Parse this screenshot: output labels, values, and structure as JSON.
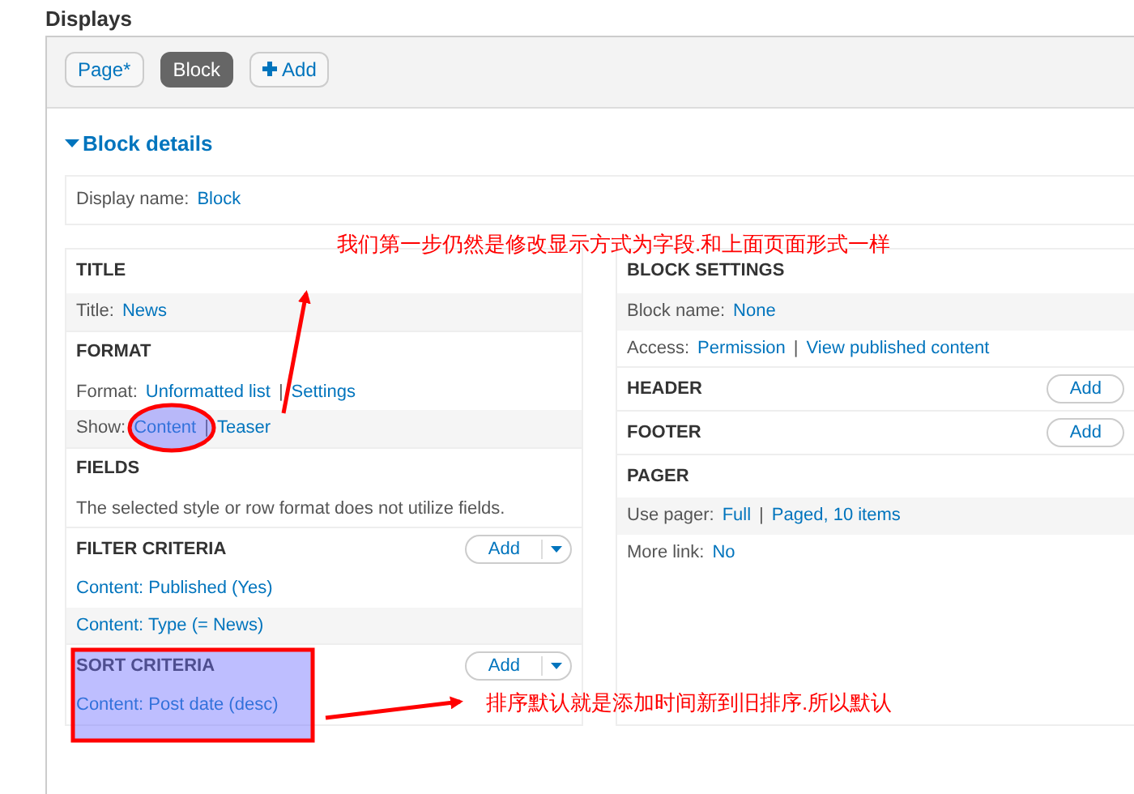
{
  "page_title": "Displays",
  "tabs": [
    {
      "label": "Page*",
      "kind": "tab",
      "selected": false
    },
    {
      "label": "Block",
      "kind": "tab",
      "selected": true
    },
    {
      "label": "Add",
      "kind": "add",
      "selected": false
    }
  ],
  "details": {
    "heading": "Block details",
    "expanded": true,
    "display_name": {
      "label": "Display name:",
      "value": "Block"
    }
  },
  "left_sections": [
    {
      "title": "TITLE",
      "rows": [
        {
          "striped": true,
          "parts": [
            {
              "kind": "label",
              "text": "Title:"
            },
            {
              "kind": "link",
              "text": "News"
            }
          ]
        }
      ]
    },
    {
      "title": "FORMAT",
      "rows": [
        {
          "parts": [
            {
              "kind": "label",
              "text": "Format:"
            },
            {
              "kind": "link",
              "text": "Unformatted list"
            },
            {
              "kind": "sep",
              "text": "|"
            },
            {
              "kind": "link",
              "text": "Settings"
            }
          ]
        },
        {
          "striped": true,
          "parts": [
            {
              "kind": "label",
              "text": "Show:"
            },
            {
              "kind": "link",
              "text": "Content"
            },
            {
              "kind": "sep",
              "text": "|"
            },
            {
              "kind": "link",
              "text": "Teaser"
            }
          ]
        }
      ]
    },
    {
      "title": "FIELDS",
      "rows": [
        {
          "parts": [
            {
              "kind": "label",
              "text": "The selected style or row format does not utilize fields."
            }
          ]
        }
      ]
    },
    {
      "title": "FILTER CRITERIA",
      "add": {
        "label": "Add",
        "dropdown": true
      },
      "rows": [
        {
          "parts": [
            {
              "kind": "link",
              "text": "Content: Published (Yes)"
            }
          ]
        },
        {
          "striped": true,
          "parts": [
            {
              "kind": "link",
              "text": "Content: Type (= News)"
            }
          ]
        }
      ]
    },
    {
      "title": "SORT CRITERIA",
      "add": {
        "label": "Add",
        "dropdown": true
      },
      "rows": [
        {
          "parts": [
            {
              "kind": "link",
              "text": "Content: Post date (desc)"
            }
          ]
        }
      ]
    }
  ],
  "right_sections": [
    {
      "title": "BLOCK SETTINGS",
      "rows": [
        {
          "striped": true,
          "parts": [
            {
              "kind": "label",
              "text": "Block name:"
            },
            {
              "kind": "link",
              "text": "None"
            }
          ]
        },
        {
          "parts": [
            {
              "kind": "label",
              "text": "Access:"
            },
            {
              "kind": "link",
              "text": "Permission"
            },
            {
              "kind": "sep",
              "text": "|"
            },
            {
              "kind": "link",
              "text": "View published content"
            }
          ]
        }
      ]
    },
    {
      "title": "HEADER",
      "add": {
        "label": "Add",
        "dropdown": false
      }
    },
    {
      "title": "FOOTER",
      "add": {
        "label": "Add",
        "dropdown": false
      }
    },
    {
      "title": "PAGER",
      "rows": [
        {
          "striped": true,
          "parts": [
            {
              "kind": "label",
              "text": "Use pager:"
            },
            {
              "kind": "link",
              "text": "Full"
            },
            {
              "kind": "sep",
              "text": "|"
            },
            {
              "kind": "link",
              "text": "Paged, 10 items"
            }
          ]
        },
        {
          "parts": [
            {
              "kind": "label",
              "text": "More link:"
            },
            {
              "kind": "link",
              "text": "No"
            }
          ]
        }
      ]
    }
  ],
  "annotations": [
    {
      "kind": "note",
      "text": "我们第一步仍然是修改显示方式为字段.和上面页面形式一样"
    },
    {
      "kind": "arrow"
    },
    {
      "kind": "ellipse"
    },
    {
      "kind": "box"
    },
    {
      "kind": "arrow"
    },
    {
      "kind": "note",
      "text": "排序默认就是添加时间新到旧排序.所以默认"
    }
  ]
}
